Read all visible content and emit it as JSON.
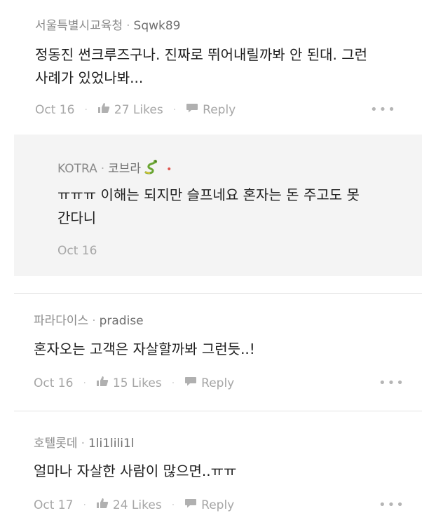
{
  "comments": [
    {
      "org": "서울특별시교육청",
      "user": "Sqwk89",
      "text_lines": [
        "정동진 썬크루즈구나. 진짜로 뛰어내릴까봐 안 된대. 그런",
        "사례가 있었나봐..."
      ],
      "date": "Oct 16",
      "likes": "27 Likes",
      "reply": "Reply",
      "more": "•••"
    },
    {
      "org": "파라다이스",
      "user": "pradise",
      "text_lines": [
        "혼자오는 고객은 자살할까봐 그런듯..!"
      ],
      "date": "Oct 16",
      "likes": "15 Likes",
      "reply": "Reply",
      "more": "•••"
    },
    {
      "org": "호텔롯데",
      "user": "1li1lili1l",
      "text_lines": [
        "얼마나 자살한 사람이 많으면..ㅠㅠ"
      ],
      "date": "Oct 17",
      "likes": "24 Likes",
      "reply": "Reply",
      "more": "•••"
    }
  ],
  "reply": {
    "org": "KOTRA",
    "user": "코브라",
    "icon": "snake-emoji",
    "text_lines": [
      "ㅠㅠㅠ 이해는 되지만 슬프네요 혼자는 돈 주고도 못",
      "간다니"
    ],
    "date": "Oct 16"
  },
  "colors": {
    "reply_background": "#f4f4f4",
    "divider": "#e4e4e4",
    "muted_text": "#a6a6a6",
    "body_text": "#202020",
    "new_badge_dot": "#e0564f"
  }
}
